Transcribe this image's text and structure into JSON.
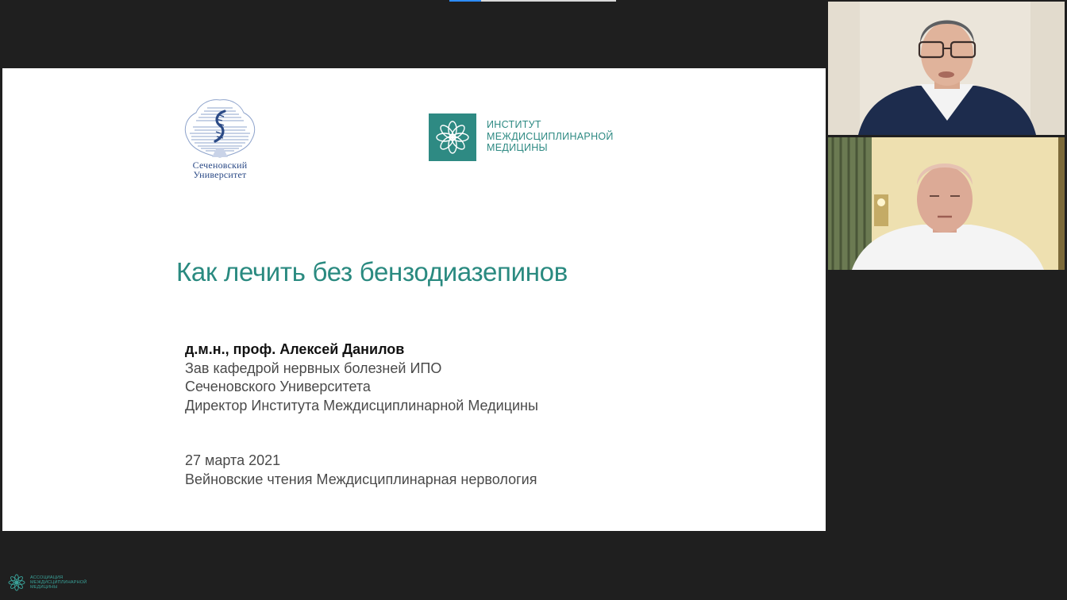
{
  "slide": {
    "sechenov_logo": {
      "line1": "Сеченовский",
      "line2": "Университет"
    },
    "institute_logo": {
      "line1": "ИНСТИТУТ",
      "line2": "МЕЖДИСЦИПЛИНАРНОЙ",
      "line3": "МЕДИЦИНЫ"
    },
    "title": "Как лечить без бензодиазепинов",
    "author": {
      "name": "д.м.н., проф. Алексей Данилов",
      "position_line1": "Зав кафедрой нервных болезней  ИПО",
      "position_line2": "Сеченовского Университета",
      "position_line3": "Директор Института Междисциплинарной Медицины"
    },
    "event": {
      "date": "27 марта 2021",
      "name": "Вейновские чтения Междисциплинарная нервология"
    }
  },
  "watermark": {
    "line1": "АССОЦИАЦИЯ",
    "line2": "МЕЖДИСЦИПЛИНАРНОЙ",
    "line3": "МЕДИЦИНЫ"
  },
  "colors": {
    "background": "#1f1f1f",
    "slide_background": "#ffffff",
    "accent_teal": "#2a8a80",
    "sechenov_blue": "#2b4a86",
    "text_gray": "#4a4a4a"
  }
}
